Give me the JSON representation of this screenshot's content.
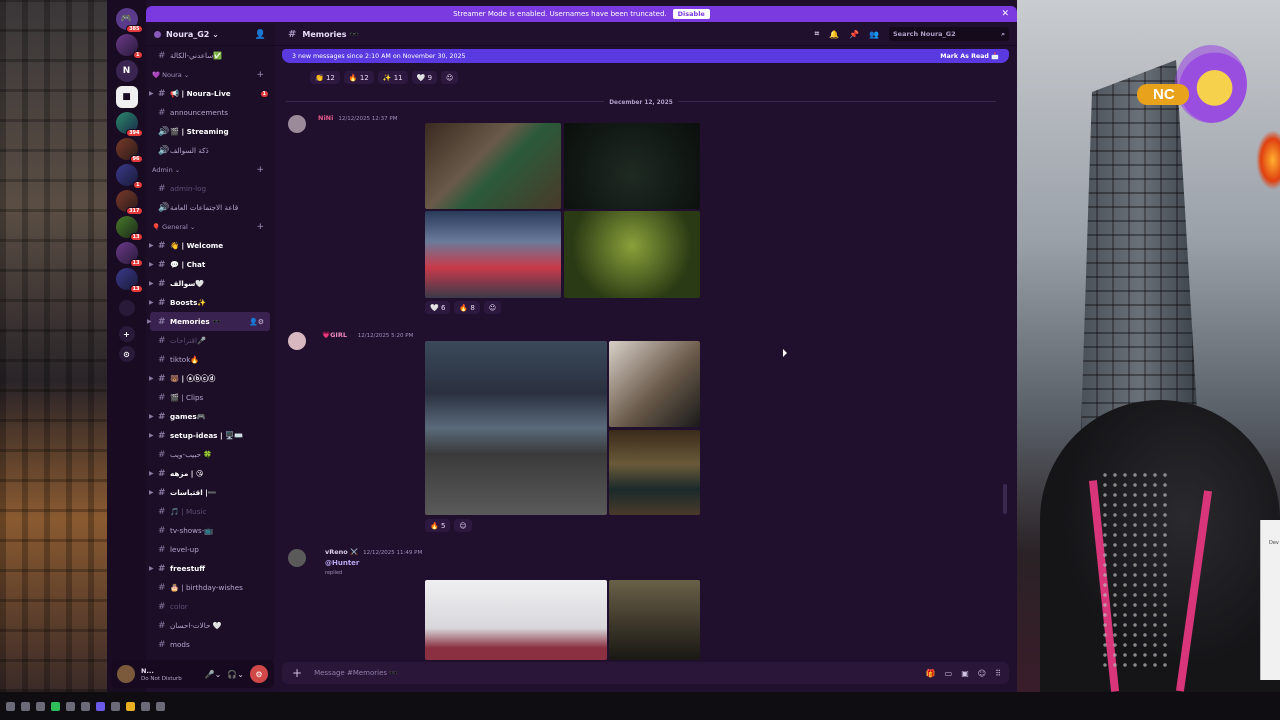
{
  "banner": {
    "text": "Streamer Mode is enabled. Usernames have been truncated.",
    "disable": "Disable"
  },
  "guild_badges": {
    "top": "385",
    "g1": "1",
    "g4": "394",
    "g5": "96",
    "g6": "1",
    "g7": "317",
    "g8": "13",
    "g9": "13",
    "g10": "13"
  },
  "guild_letter": "N",
  "server": {
    "name": "Noura_G2"
  },
  "channels": {
    "top": "ساعدني-الكالة✅",
    "cat_noura": "💜 Noura",
    "noura_live": "📢 | Noura-Live",
    "noura_live_badge": "1",
    "announcements": "announcements",
    "streaming": "🎬 | Streaming",
    "lobby": "دَكة السوالف",
    "cat_admin": "Admin",
    "admin_log": "admin-log",
    "public_hall": "قاعة الاجتماعات العامة",
    "cat_general": "🎈 General",
    "welcome": "👋 | Welcome",
    "chat": "💬 | Chat",
    "hearts": "سوالف🤍",
    "boosts": "Boosts✨",
    "memories": "Memories 🕶️",
    "suggestions": "اقتراحات🎤",
    "tiktok": "tiktok🔥",
    "circles": "🐻 | ⓐⓑⓒⓓ",
    "clips": "🎬 | Clips",
    "games": "games🎮",
    "setup": "setup-ideas | 🖥️⌨️",
    "ontime": "حبيب-ويب 🍀",
    "mood": "مزهه | 😘",
    "quotes": "اقتباسات |➖",
    "music": "🎵 | Music",
    "tvshows": "tv-shows-📺",
    "levelup": "level-up",
    "freestuff": "freestuff",
    "birthday": "🎂 | birthday-wishes",
    "color": "color",
    "status_ch": "حالات-احسان 🤍",
    "mods": "mods"
  },
  "user": {
    "name": "N...",
    "status": "Do Not Disturb"
  },
  "header": {
    "channel": "Memories 🕶️",
    "search_placeholder": "Search Noura_G2"
  },
  "new_messages": {
    "text": "3 new messages since 2:10 AM on November 30, 2025",
    "mark": "Mark As Read"
  },
  "reactions_top": [
    {
      "e": "👏",
      "n": "12"
    },
    {
      "e": "🔥",
      "n": "12"
    },
    {
      "e": "✨",
      "n": "11"
    },
    {
      "e": "🤍",
      "n": "9"
    }
  ],
  "divider": "December 12, 2025",
  "msg1": {
    "name": "NiNi",
    "time": "12/12/2025 12:37 PM",
    "reactions": [
      {
        "e": "🤍",
        "n": "6"
      },
      {
        "e": "🔥",
        "n": "8"
      }
    ]
  },
  "msg2": {
    "name": "💗GIRL",
    "time": "12/12/2025 5:20 PM",
    "reactions": [
      {
        "e": "🔥",
        "n": "5"
      }
    ]
  },
  "msg3": {
    "name": "vReno ⚔️",
    "time": "12/12/2025 11:49 PM",
    "mention": "@Hunter",
    "sub": "replied"
  },
  "composer": {
    "placeholder": "Message #Memories 🕶️"
  },
  "overlay": {
    "nc": "NC"
  },
  "popup": {
    "text": "Dev"
  }
}
